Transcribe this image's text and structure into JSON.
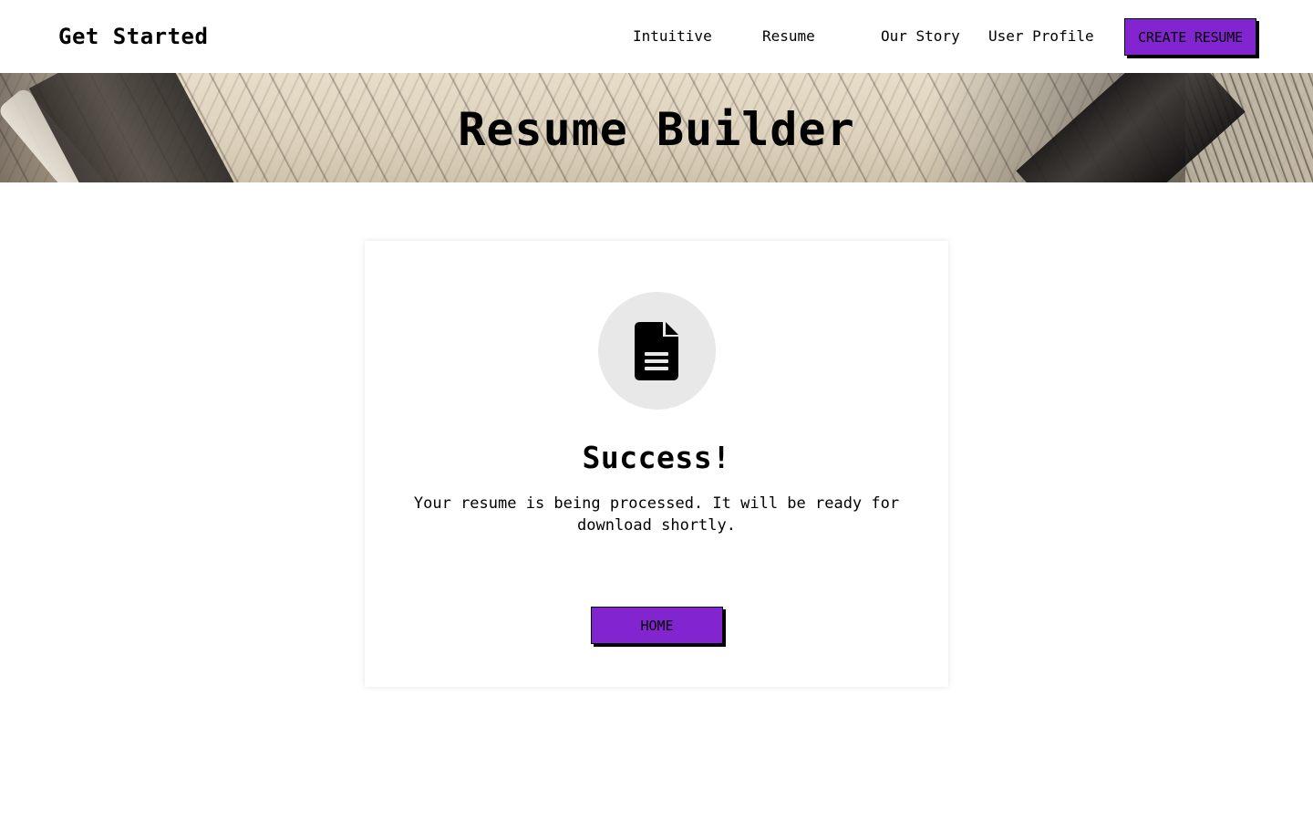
{
  "header": {
    "brand": "Get Started",
    "nav": [
      {
        "label": "Intuitive"
      },
      {
        "label": "Resume"
      },
      {
        "label": "Our Story"
      },
      {
        "label": "User Profile"
      }
    ],
    "cta_label": "CREATE RESUME"
  },
  "banner": {
    "title": "Resume Builder"
  },
  "card": {
    "icon": "document-icon",
    "title": "Success!",
    "message": "Your resume is being processed. It will be ready for download shortly.",
    "button_label": "HOME"
  },
  "colors": {
    "accent": "#8324d1",
    "icon_circle": "#e8e8e8"
  }
}
